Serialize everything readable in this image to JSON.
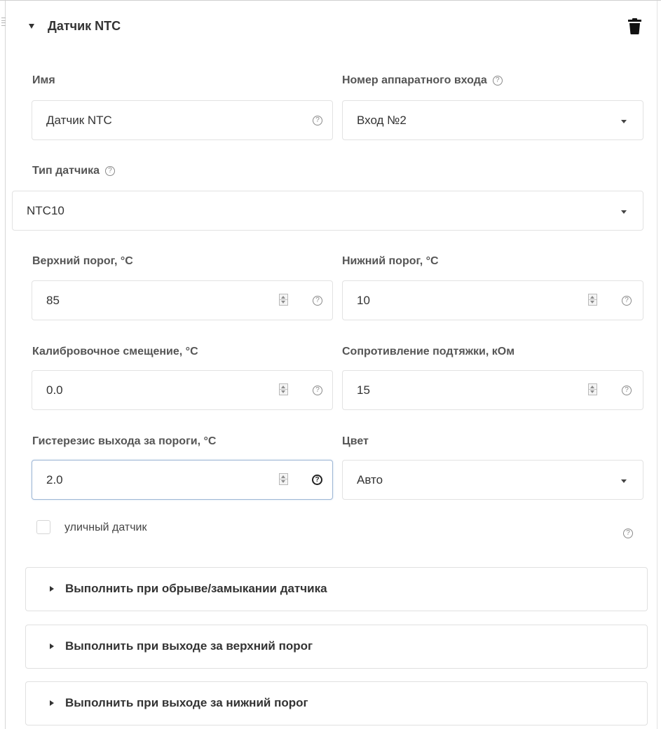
{
  "panel": {
    "title": "Датчик NTC",
    "icons": {
      "expand": "caret-down-icon",
      "delete": "trash-icon",
      "drag": "drag-handle-icon"
    }
  },
  "fields": {
    "name": {
      "label": "Имя",
      "value": "Датчик NTC"
    },
    "hardware_input": {
      "label": "Номер аппаратного входа",
      "value": "Вход №2"
    },
    "sensor_type": {
      "label": "Тип датчика",
      "value": "NTC10"
    },
    "upper_threshold": {
      "label": "Верхний порог, °C",
      "value": "85"
    },
    "lower_threshold": {
      "label": "Нижний порог, °C",
      "value": "10"
    },
    "calibration_offset": {
      "label": "Калибровочное смещение, °C",
      "value": "0.0"
    },
    "pullup_resistance": {
      "label": "Сопротивление подтяжки, кОм",
      "value": "15"
    },
    "hysteresis": {
      "label": "Гистерезис выхода за пороги, °C",
      "value": "2.0"
    },
    "color": {
      "label": "Цвет",
      "value": "Авто"
    }
  },
  "outdoor_sensor": {
    "label": "уличный датчик",
    "checked": false
  },
  "help_symbol": "?",
  "actions": [
    {
      "label": "Выполнить при обрыве/замыкании датчика"
    },
    {
      "label": "Выполнить при выходе за верхний порог"
    },
    {
      "label": "Выполнить при выходе за нижний порог"
    }
  ],
  "colors": {
    "label_text": "#555555",
    "field_border": "#e2e2e2",
    "focus_border": "#9fb8d6"
  }
}
